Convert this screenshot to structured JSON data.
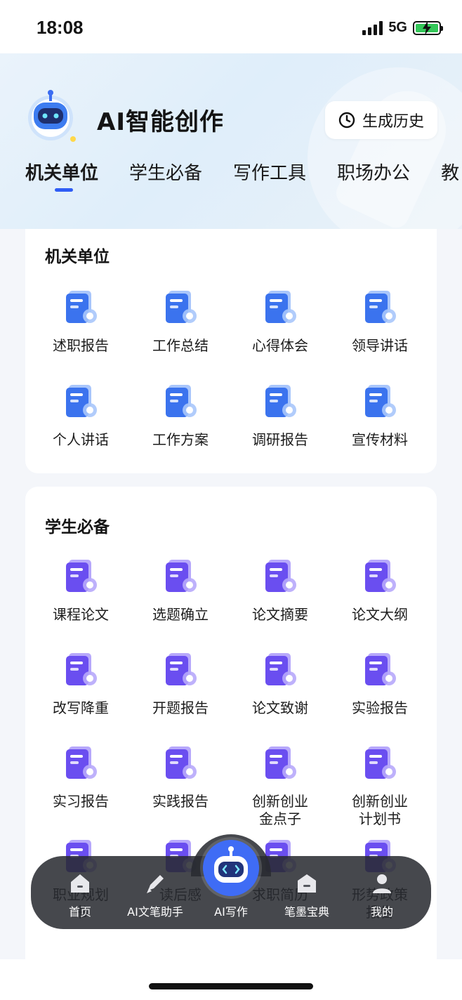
{
  "status": {
    "time": "18:08",
    "network": "5G"
  },
  "header": {
    "title": "AI智能创作",
    "history_label": "生成历史",
    "tabs": [
      "机关单位",
      "学生必备",
      "写作工具",
      "职场办公",
      "教"
    ]
  },
  "sections": [
    {
      "title": "机关单位",
      "items": [
        {
          "label": "述职报告",
          "icon": "report-pen-icon"
        },
        {
          "label": "工作总结",
          "icon": "folder-check-icon"
        },
        {
          "label": "心得体会",
          "icon": "doc-star-icon"
        },
        {
          "label": "领导讲话",
          "icon": "doc-chat-icon"
        },
        {
          "label": "个人讲话",
          "icon": "person-chat-icon"
        },
        {
          "label": "工作方案",
          "icon": "folder-layers-icon"
        },
        {
          "label": "调研报告",
          "icon": "clipboard-chart-icon"
        },
        {
          "label": "宣传材料",
          "icon": "envelope-check-icon"
        }
      ]
    },
    {
      "title": "学生必备",
      "items": [
        {
          "label": "课程论文",
          "icon": "paper-pen-icon"
        },
        {
          "label": "选题确立",
          "icon": "checklist-star-icon"
        },
        {
          "label": "论文摘要",
          "icon": "clipboard-quote-icon"
        },
        {
          "label": "论文大纲",
          "icon": "outline-flow-icon"
        },
        {
          "label": "改写降重",
          "icon": "doc-search-icon"
        },
        {
          "label": "开题报告",
          "icon": "doc-pen-icon"
        },
        {
          "label": "论文致谢",
          "icon": "text-heart-icon"
        },
        {
          "label": "实验报告",
          "icon": "molecule-doc-icon"
        },
        {
          "label": "实习报告",
          "icon": "clipboard-badge-icon"
        },
        {
          "label": "实践报告",
          "icon": "clipboard-pie-icon"
        },
        {
          "label": "创新创业\n金点子",
          "icon": "doc-upload-icon"
        },
        {
          "label": "创新创业\n计划书",
          "icon": "doc-flag-icon"
        },
        {
          "label": "职业规划\n书",
          "icon": "career-doc-icon"
        },
        {
          "label": "读后感",
          "icon": "book-icon"
        },
        {
          "label": "求职简历",
          "icon": "resume-icon"
        },
        {
          "label": "形势政策\n报告",
          "icon": "policy-doc-icon"
        }
      ]
    }
  ],
  "bottom_nav": [
    {
      "label": "首页",
      "icon": "home-icon"
    },
    {
      "label": "AI文笔助手",
      "icon": "pen-icon"
    },
    {
      "label": "AI写作",
      "icon": "robot-icon"
    },
    {
      "label": "笔墨宝典",
      "icon": "book-house-icon"
    },
    {
      "label": "我的",
      "icon": "user-icon"
    }
  ],
  "colors": {
    "accent": "#2f5df5",
    "blue_icon": "#3d7cf0",
    "purple_icon": "#6b4ff0"
  }
}
